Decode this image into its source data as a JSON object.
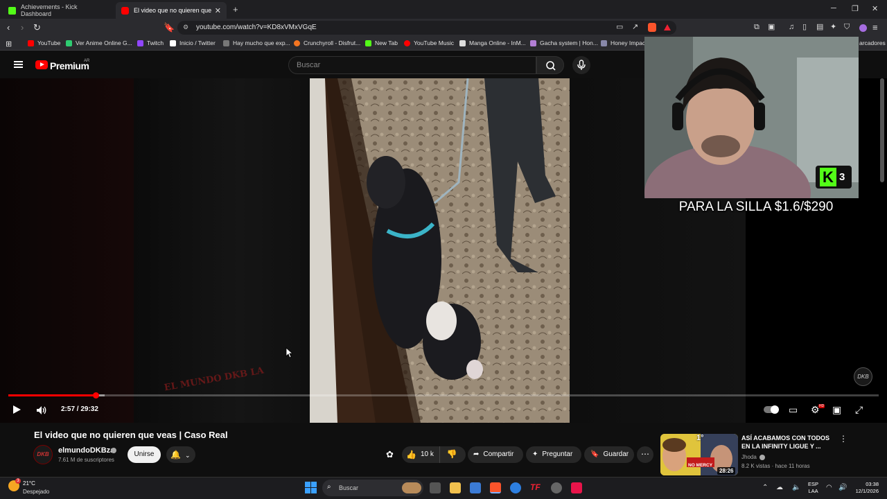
{
  "browser": {
    "tabs": [
      {
        "label": "Achievements - Kick Dashboard",
        "color": "#53fc18"
      },
      {
        "label": "El video que no quieren que vea",
        "color": "#ff0000",
        "active": true
      }
    ],
    "new_tab": "+",
    "url": "youtube.com/watch?v=KD8xVMxVGqE",
    "bookmarks": [
      {
        "label": "YouTube",
        "color": "#ff0000"
      },
      {
        "label": "Ver Anime Online G...",
        "color": "#2ecc71"
      },
      {
        "label": "Twitch",
        "color": "#9146ff"
      },
      {
        "label": "Inicio / Twitter",
        "color": "#ffffff"
      },
      {
        "label": "Hay mucho que exp...",
        "color": "#777777"
      },
      {
        "label": "Crunchyroll - Disfrut...",
        "color": "#f47521"
      },
      {
        "label": "New Tab",
        "color": "#53fc18"
      },
      {
        "label": "YouTube Music",
        "color": "#ff0000"
      },
      {
        "label": "Manga Online - InM...",
        "color": "#dddddd"
      },
      {
        "label": "Gacha system | Hon...",
        "color": "#b37fd6"
      },
      {
        "label": "Honey Impac",
        "color": "#8888aa"
      }
    ],
    "bookmarks_overflow": "arcadores"
  },
  "youtube": {
    "brand": "Premium",
    "region": "AR",
    "search_placeholder": "Buscar"
  },
  "overlay": {
    "stream_goal": "PARA LA SILLA $1.6/$290",
    "kick_count": "3",
    "watermark": "EL MUNDO DKB LA",
    "corner_logo": "DKB"
  },
  "player": {
    "time": "2:57 / 29:32",
    "progress": 0.1,
    "buffered": 0.111,
    "autoplay_on": true
  },
  "video": {
    "title": "El video que no quieren que veas | Caso Real",
    "channel": "elmundoDKBza",
    "subscribers": "7.61 M de suscriptores",
    "join_label": "Unirse",
    "likes": "10 k",
    "share_label": "Compartir",
    "ask_label": "Preguntar",
    "save_label": "Guardar"
  },
  "recommendation": {
    "title": "ASÍ ACABAMOS CON TODOS EN LA INFINITY LIGUE Y ...",
    "channel": "Jhoda",
    "meta": "8.2 K vistas · hace 11 horas",
    "duration": "28:26",
    "thumb_text": "NO MERCY",
    "thumb_rank": "1°"
  },
  "taskbar": {
    "temperature": "21°C",
    "condition": "Despejado",
    "weather_badge": "3",
    "search_label": "Buscar",
    "lang_line1": "ESP",
    "lang_line2": "LAA",
    "time": "03:38",
    "date": "12/1/2026"
  }
}
